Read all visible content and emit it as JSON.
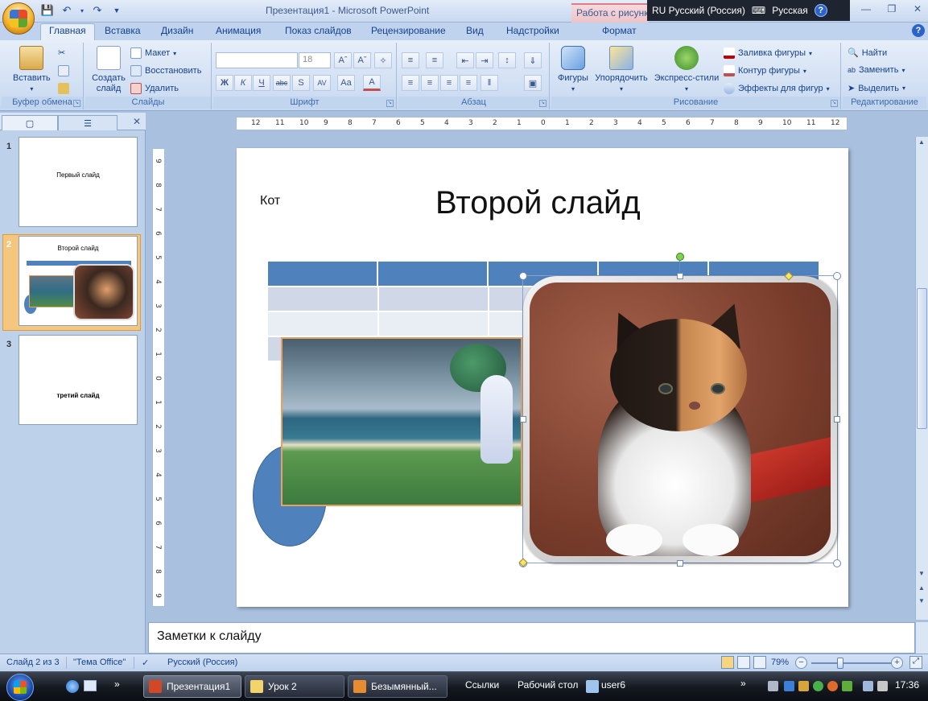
{
  "window": {
    "title": "Презентация1 - Microsoft PowerPoint",
    "context_tab_header": "Работа с рисунками",
    "language_indicator": "RU Русский (Россия)",
    "keyboard_layout": "Русская",
    "help": "?"
  },
  "ribbon_tabs": [
    {
      "label": "Главная",
      "active": true
    },
    {
      "label": "Вставка"
    },
    {
      "label": "Дизайн"
    },
    {
      "label": "Анимация"
    },
    {
      "label": "Показ слайдов"
    },
    {
      "label": "Рецензирование"
    },
    {
      "label": "Вид"
    },
    {
      "label": "Надстройки"
    },
    {
      "label": "Формат"
    }
  ],
  "ribbon": {
    "clipboard": {
      "paste": "Вставить",
      "label": "Буфер обмена"
    },
    "slides": {
      "new_slide_line1": "Создать",
      "new_slide_line2": "слайд",
      "layout": "Макет",
      "reset": "Восстановить",
      "delete": "Удалить",
      "label": "Слайды"
    },
    "font": {
      "font_size": "18",
      "label": "Шрифт"
    },
    "paragraph": {
      "label": "Абзац"
    },
    "drawing": {
      "shapes": "Фигуры",
      "arrange": "Упорядочить",
      "quick_styles": "Экспресс-стили",
      "shape_fill": "Заливка фигуры",
      "shape_outline": "Контур фигуры",
      "shape_effects": "Эффекты для фигур",
      "label": "Рисование"
    },
    "editing": {
      "find": "Найти",
      "replace": "Заменить",
      "select": "Выделить",
      "label": "Редактирование"
    }
  },
  "slides_panel": {
    "slides": [
      {
        "number": "1",
        "title": "Первый слайд"
      },
      {
        "number": "2",
        "title": "Второй слайд"
      },
      {
        "number": "3",
        "title": "третий слайд"
      }
    ]
  },
  "hruler_marks": [
    "12",
    "11",
    "10",
    "9",
    "8",
    "7",
    "6",
    "5",
    "4",
    "3",
    "2",
    "1",
    "0",
    "1",
    "2",
    "3",
    "4",
    "5",
    "6",
    "7",
    "8",
    "9",
    "10",
    "11",
    "12"
  ],
  "vruler_marks": [
    "9",
    "8",
    "7",
    "6",
    "5",
    "4",
    "3",
    "2",
    "1",
    "0",
    "1",
    "2",
    "3",
    "4",
    "5",
    "6",
    "7",
    "8",
    "9"
  ],
  "slide": {
    "caption": "Кот",
    "title": "Второй слайд"
  },
  "notes": {
    "placeholder": "Заметки к слайду"
  },
  "statusbar": {
    "slide_counter": "Слайд 2 из 3",
    "theme": "\"Тема Office\"",
    "language": "Русский (Россия)",
    "zoom": "79%"
  },
  "taskbar": {
    "buttons": [
      {
        "label": "Презентация1",
        "active": true
      },
      {
        "label": "Урок 2"
      },
      {
        "label": "Безымянный..."
      }
    ],
    "toolbar_links": "Ссылки",
    "desktop": "Рабочий стол",
    "user_folder": "user6",
    "clock": "17:36"
  },
  "colors": {
    "table_header": "#4f81bd",
    "table_row_light": "#d0d8e8",
    "table_row_lighter": "#e9edf4",
    "oval": "#4f81bd"
  }
}
